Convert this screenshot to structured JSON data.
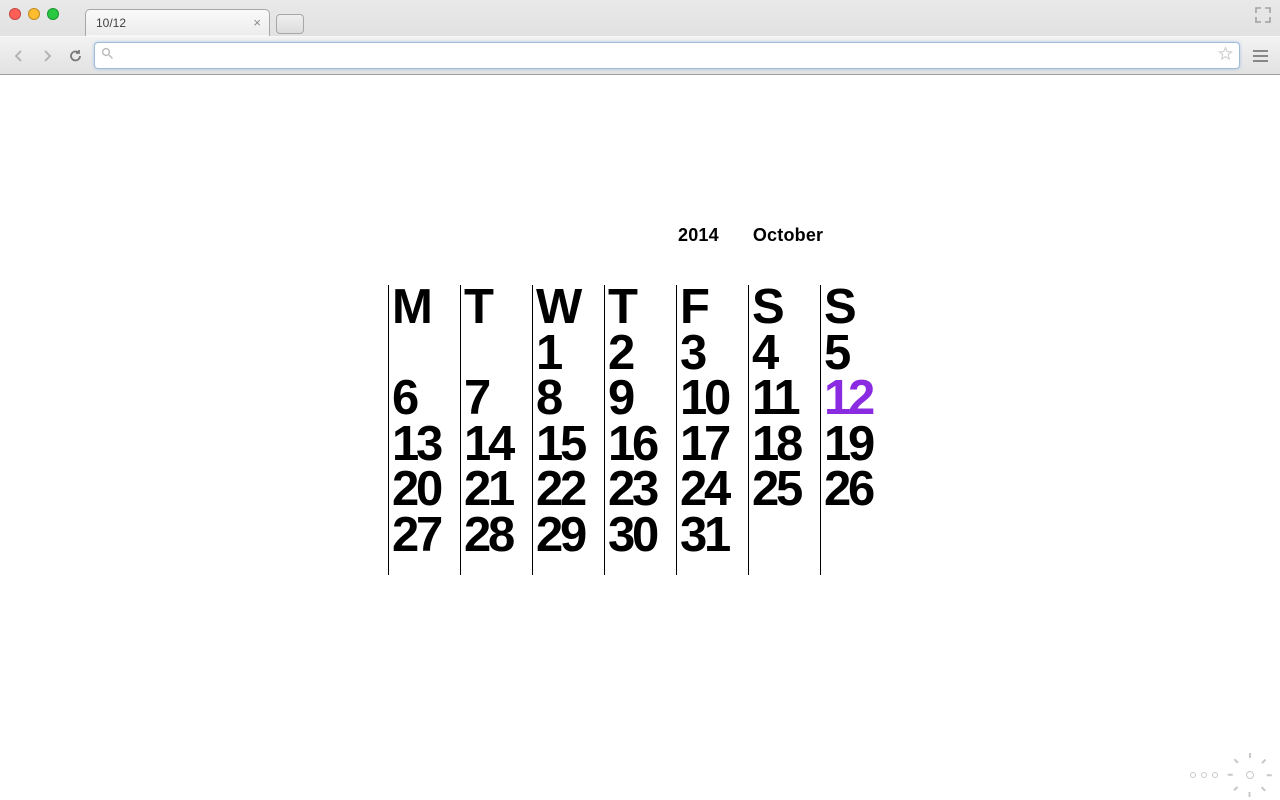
{
  "browser": {
    "tab_title": "10/12",
    "url": ""
  },
  "calendar": {
    "year": "2014",
    "month": "October",
    "today_index": 12,
    "day_headers": [
      "M",
      "T",
      "W",
      "T",
      "F",
      "S",
      "S"
    ],
    "columns": [
      [
        "",
        "6",
        "13",
        "20",
        "27"
      ],
      [
        "",
        "7",
        "14",
        "21",
        "28"
      ],
      [
        "1",
        "8",
        "15",
        "22",
        "29"
      ],
      [
        "2",
        "9",
        "16",
        "23",
        "30"
      ],
      [
        "3",
        "10",
        "17",
        "24",
        "31"
      ],
      [
        "4",
        "11",
        "18",
        "25",
        ""
      ],
      [
        "5",
        "12",
        "19",
        "26",
        ""
      ]
    ],
    "highlight_color": "#8a2be2"
  }
}
